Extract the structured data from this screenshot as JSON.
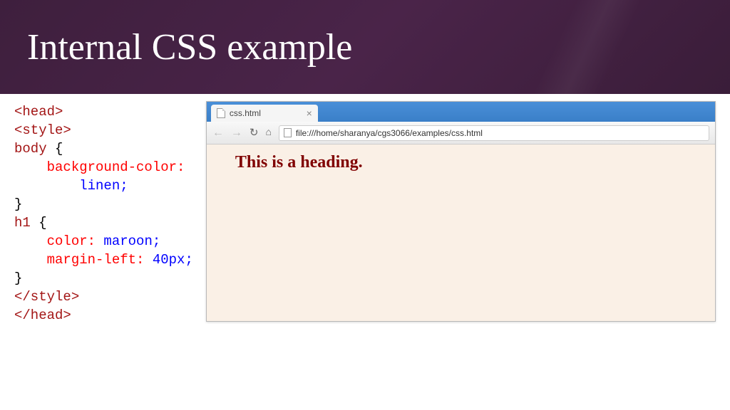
{
  "header": {
    "title": "Internal CSS example"
  },
  "code": {
    "l1": "<head>",
    "l2": "<style>",
    "l3_sel": "body",
    "l3_brace": " {",
    "l4_prop": "background-color:",
    "l5_val": "linen;",
    "l6": "}",
    "l7_sel": "h1",
    "l7_brace": " {",
    "l8_prop": "color:",
    "l8_val": " maroon;",
    "l9_prop": "margin-left:",
    "l9_val": " 40px;",
    "l10": "}",
    "l11": "</style>",
    "l12": "</head>"
  },
  "browser": {
    "tab_title": "css.html",
    "url": "file:///home/sharanya/cgs3066/examples/css.html",
    "heading": "This is a heading."
  }
}
